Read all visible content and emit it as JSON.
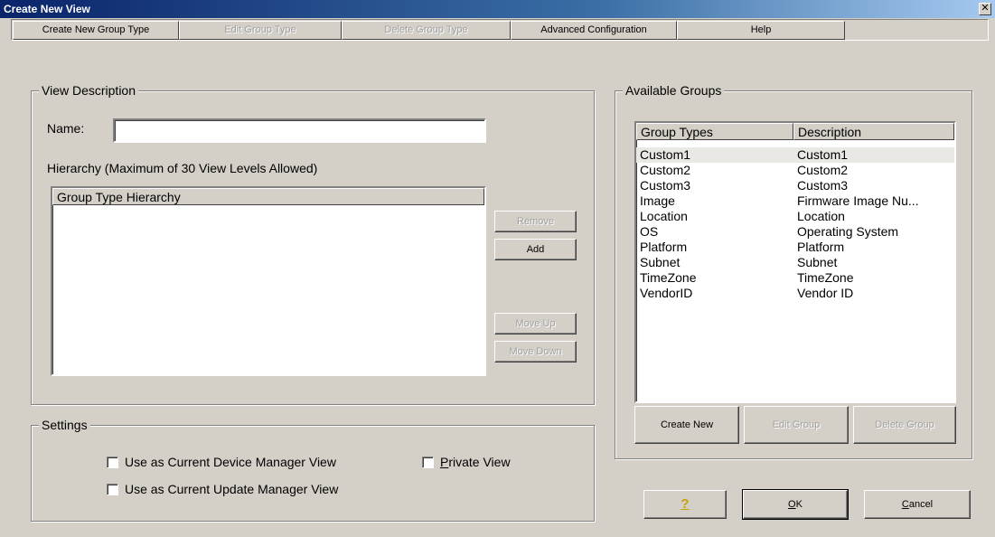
{
  "window": {
    "title": "Create New View",
    "close_glyph": "✕"
  },
  "menubar": {
    "items": [
      {
        "label": "Create New Group Type",
        "enabled": true
      },
      {
        "label": "Edit Group Type",
        "enabled": false
      },
      {
        "label": "Delete Group Type",
        "enabled": false
      },
      {
        "label": "Advanced Configuration",
        "enabled": true
      },
      {
        "label": "Help",
        "enabled": true
      }
    ]
  },
  "view_description": {
    "legend": "View Description",
    "name_label": "Name:",
    "name_value": "",
    "hierarchy_label": "Hierarchy (Maximum of 30 View Levels Allowed)",
    "hierarchy_column": "Group Type Hierarchy",
    "buttons": {
      "remove": "Remove",
      "add": "Add",
      "move_up": "Move Up",
      "move_down": "Move Down"
    }
  },
  "settings": {
    "legend": "Settings",
    "device_manager_view": {
      "label": "Use as Current Device Manager View",
      "checked": false
    },
    "update_manager_view": {
      "label": "Use as Current Update Manager View",
      "checked": false
    },
    "private_view": {
      "label_accel": "P",
      "label_rest": "rivate View",
      "checked": false
    }
  },
  "available_groups": {
    "legend": "Available Groups",
    "columns": [
      "Group Types",
      "Description"
    ],
    "rows": [
      {
        "type": "Custom1",
        "description": "Custom1"
      },
      {
        "type": "Custom2",
        "description": "Custom2"
      },
      {
        "type": "Custom3",
        "description": "Custom3"
      },
      {
        "type": "Image",
        "description": "Firmware Image Nu..."
      },
      {
        "type": "Location",
        "description": "Location"
      },
      {
        "type": "OS",
        "description": "Operating System"
      },
      {
        "type": "Platform",
        "description": "Platform"
      },
      {
        "type": "Subnet",
        "description": "Subnet"
      },
      {
        "type": "TimeZone",
        "description": "TimeZone"
      },
      {
        "type": "VendorID",
        "description": "Vendor ID"
      }
    ],
    "selected_index": 0,
    "buttons": {
      "create_new": "Create New",
      "edit_group": "Edit Group",
      "delete_group": "Delete Group"
    }
  },
  "footer": {
    "help_glyph": "?",
    "ok_accel": "O",
    "ok_rest": "K",
    "cancel_accel": "C",
    "cancel_rest": "ancel"
  }
}
